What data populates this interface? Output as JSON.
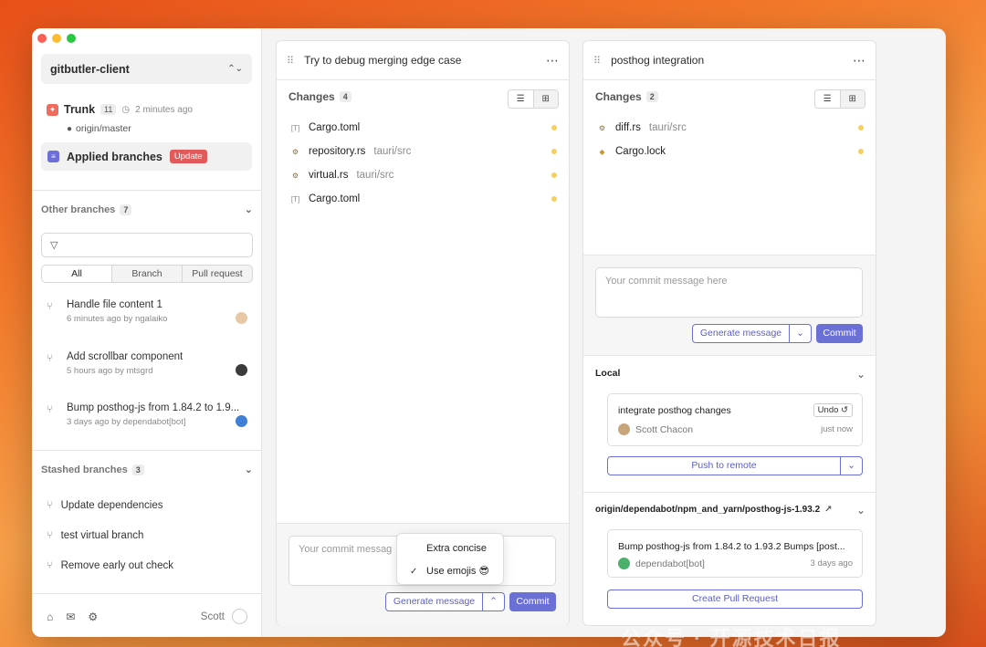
{
  "colors": {
    "accent": "#6b70d6",
    "update": "#e25a5a",
    "modified_dot": "#f5cf60",
    "trunk": "#f06a5d"
  },
  "sidebar": {
    "project": "gitbutler-client",
    "trunk": {
      "label": "Trunk",
      "count": "11",
      "time": "2 minutes ago",
      "remote": "origin/master"
    },
    "applied": {
      "label": "Applied branches",
      "badge": "Update"
    },
    "other": {
      "label": "Other branches",
      "count": "7"
    },
    "filter_tabs": [
      "All",
      "Branch",
      "Pull request"
    ],
    "branches": [
      {
        "title": "Handle file content 1",
        "sub": "6 minutes ago by ngalaiko"
      },
      {
        "title": "Add scrollbar component",
        "sub": "5 hours ago by mtsgrd"
      },
      {
        "title": "Bump posthog-js from 1.84.2 to 1.9...",
        "sub": "3 days ago by dependabot[bot]"
      }
    ],
    "stashed": {
      "label": "Stashed branches",
      "count": "3"
    },
    "stashed_items": [
      "Update dependencies",
      "test virtual branch",
      "Remove early out check"
    ],
    "user": "Scott"
  },
  "lane1": {
    "title": "Try to debug merging edge case",
    "changes_label": "Changes",
    "changes_count": "4",
    "files": [
      {
        "name": "Cargo.toml",
        "path": "",
        "icon": "toml-icon"
      },
      {
        "name": "repository.rs",
        "path": "tauri/src",
        "icon": "rust-icon"
      },
      {
        "name": "virtual.rs",
        "path": "tauri/src",
        "icon": "rust-icon"
      },
      {
        "name": "Cargo.toml",
        "path": "",
        "icon": "toml-icon"
      }
    ],
    "commit_placeholder": "Your commit messag",
    "generate": "Generate message",
    "commit": "Commit",
    "menu": {
      "opt1": "Extra concise",
      "opt2": "Use emojis 😎"
    }
  },
  "lane2": {
    "title": "posthog integration",
    "changes_label": "Changes",
    "changes_count": "2",
    "files": [
      {
        "name": "diff.rs",
        "path": "tauri/src",
        "icon": "rust-icon"
      },
      {
        "name": "Cargo.lock",
        "path": "",
        "icon": "lock-icon"
      }
    ],
    "commit_placeholder": "Your commit message here",
    "generate": "Generate message",
    "commit": "Commit",
    "local": {
      "label": "Local",
      "commit_title": "integrate posthog changes",
      "undo": "Undo",
      "author": "Scott Chacon",
      "time": "just now",
      "push": "Push to remote"
    },
    "remote": {
      "label": "origin/dependabot/npm_and_yarn/posthog-js-1.93.2",
      "commit_title": "Bump posthog-js from 1.84.2 to 1.93.2 Bumps [post...",
      "author": "dependabot[bot]",
      "time": "3 days ago",
      "pr": "Create Pull Request"
    }
  },
  "watermark": "公众号 · 开源技术日报"
}
